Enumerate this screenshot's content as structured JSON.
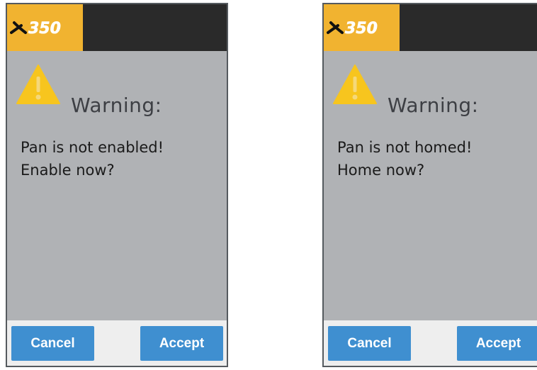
{
  "screens": [
    {
      "logo_text": "350",
      "warning_title": "Warning:",
      "message_line1": "Pan is not enabled!",
      "message_line2": "Enable now?",
      "cancel_label": "Cancel",
      "accept_label": "Accept"
    },
    {
      "logo_text": "350",
      "warning_title": "Warning:",
      "message_line1": "Pan is not homed!",
      "message_line2": "Home now?",
      "cancel_label": "Cancel",
      "accept_label": "Accept"
    }
  ],
  "colors": {
    "header_bg": "#2a2a2a",
    "logo_bg": "#f1b330",
    "screen_bg": "#b0b2b5",
    "warning_icon": "#f7c51e",
    "button_bg": "#3f8fd0",
    "footer_bg": "#eeeeee"
  },
  "icons": {
    "warning": "warning-triangle-icon",
    "logo": "x350-logo"
  }
}
